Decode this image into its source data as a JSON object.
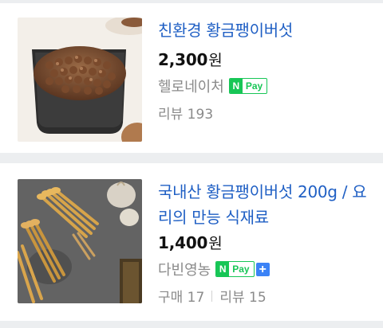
{
  "products": [
    {
      "title": "친환경 황금팽이버섯",
      "price": "2,300",
      "currency": "원",
      "seller": "헬로네이처",
      "npay_n": "N",
      "npay_label": "Pay",
      "reviews_label": "리뷰 193"
    },
    {
      "title": "국내산 황금팽이버섯 200g / 요리의 만능 식재료",
      "price": "1,400",
      "currency": "원",
      "seller": "다빈영농",
      "npay_n": "N",
      "npay_label": "Pay",
      "npay_plus": "+",
      "purchases_label": "구매 17",
      "reviews_label": "리뷰 15"
    }
  ],
  "colors": {
    "title": "#1f5fc4",
    "npay_green": "#17c656",
    "plus_blue": "#3b82f6",
    "muted_text": "#8a8a8a",
    "page_bg": "#eceef0"
  }
}
